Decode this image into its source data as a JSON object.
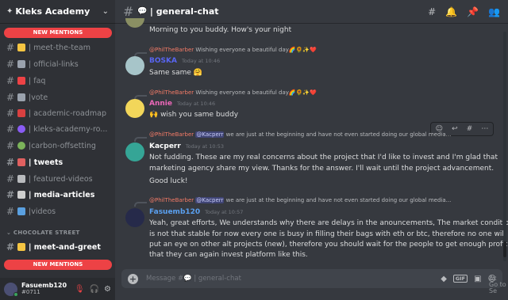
{
  "server": {
    "name": "Kleks Academy"
  },
  "sidebar": {
    "new_mentions_top": "NEW MENTIONS",
    "new_mentions_bottom": "NEW MENTIONS",
    "channels": [
      {
        "label": "| meet-the-team",
        "emoji_color": "#f5c542"
      },
      {
        "label": "| official-links",
        "emoji_color": "#9aa2ad"
      },
      {
        "label": "| faq",
        "emoji_color": "#ed4245"
      },
      {
        "label": "|vote",
        "emoji_color": "#9aa2ad"
      },
      {
        "label": "| academic-roadmap",
        "emoji_color": "#d94040"
      },
      {
        "label": "| kleks-academy-ro...",
        "emoji_color": "#8a5cf5"
      },
      {
        "label": "|carbon-offsetting",
        "emoji_color": "#7bb35a"
      },
      {
        "label": "| tweets",
        "emoji_color": "#e06060"
      },
      {
        "label": "| featured-videos",
        "emoji_color": "#b9bbbe"
      },
      {
        "label": "| media-articles",
        "emoji_color": "#cfcfcf"
      },
      {
        "label": "|videos",
        "emoji_color": "#5aa0e0"
      }
    ],
    "category": "CHOCOLATE STREET",
    "channels2": [
      {
        "label": "| meet-and-greet",
        "emoji_color": "#f5c542"
      }
    ]
  },
  "user": {
    "name": "Fasuemb120",
    "tag": "#0711"
  },
  "chat": {
    "channel_title": "| general-chat",
    "messages": [
      {
        "text": "Morning to you buddy. How's your night"
      },
      {
        "reply_name": "@PhilTheBarber",
        "reply_text": "Wishing everyone a beautiful day🌈🌻✨❤️",
        "author": "BOSKA",
        "author_color": "#5865f2",
        "time": "Today at 10:46",
        "text": "Same same 🤗"
      },
      {
        "reply_name": "@PhilTheBarber",
        "reply_text": "Wishing everyone a beautiful day🌈🌻✨❤️",
        "author": "Annie",
        "author_color": "#eb67b8",
        "time": "Today at 10:46",
        "text": "🙌 wish you same buddy"
      },
      {
        "reply_name": "@PhilTheBarber",
        "reply_mention": "@Kacperr",
        "reply_text": "we are just at the beginning and have not even started doing our global media...",
        "author": "Kacperr",
        "author_color": "#ffffff",
        "time": "Today at 10:53",
        "lines": [
          "Not fudding. These are my real concerns about the project that I'd like to invest and I'm glad that",
          "marketing agency share my view. Thanks for the answer. I'll wait until the project advancement.",
          "Good luck!"
        ]
      },
      {
        "reply_name": "@PhilTheBarber",
        "reply_mention": "@Kacperr",
        "reply_text": "we are just at the beginning and have not even started doing our global media...",
        "author": "Fasuemb120",
        "author_color": "#5aa0f0",
        "time": "Today at 10:57",
        "lines": [
          "Yeah, great efforts, We understands why there are delays in the anouncements, The market condition",
          "is not that stable for now every one is busy in filling their bags with eth or btc,  therefore no one will",
          "put an eye on other alt projects (new), therefore you should wait for the people to get enough profit",
          "that they can again invest platform like this."
        ]
      }
    ]
  },
  "composer": {
    "placeholder": "Message #💬 | general-chat"
  },
  "watermark": {
    "line1": "Ac",
    "line2": "Go to Se"
  }
}
